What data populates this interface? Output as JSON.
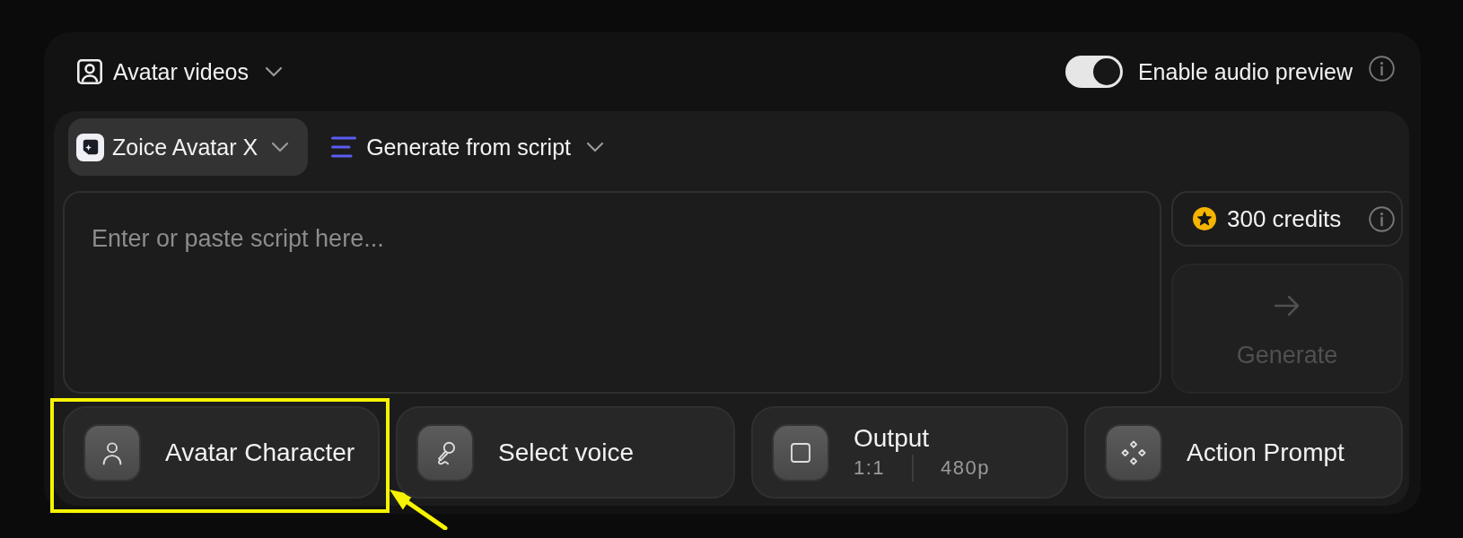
{
  "header": {
    "mode_selector": {
      "label": "Avatar videos"
    },
    "audio_preview": {
      "label": "Enable audio preview",
      "on": true
    }
  },
  "composer": {
    "model_selector": {
      "label": "Zoice Avatar X"
    },
    "source_selector": {
      "label": "Generate from script"
    },
    "script": {
      "placeholder": "Enter or paste script here..."
    },
    "credits": {
      "label": "300 credits"
    },
    "generate": {
      "label": "Generate",
      "disabled": true
    },
    "options": [
      {
        "kind": "avatar",
        "label": "Avatar Character",
        "highlighted": true
      },
      {
        "kind": "voice",
        "label": "Select voice",
        "highlighted": false
      },
      {
        "kind": "output",
        "label": "Output",
        "details": [
          "1:1",
          "480p"
        ],
        "highlighted": false
      },
      {
        "kind": "action",
        "label": "Action Prompt",
        "highlighted": false
      }
    ]
  }
}
